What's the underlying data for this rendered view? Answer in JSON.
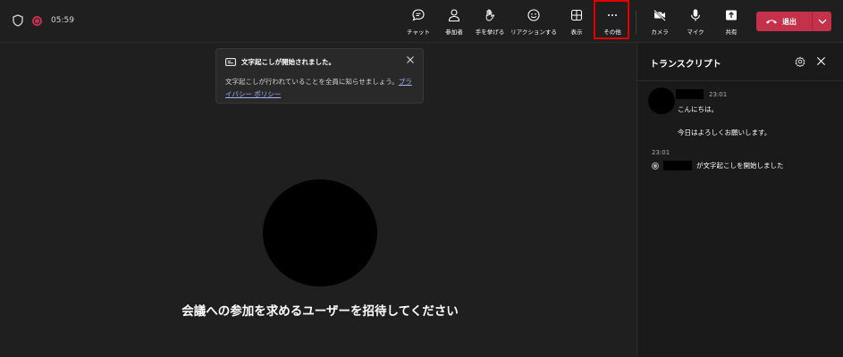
{
  "meeting": {
    "elapsed": "05:59"
  },
  "toolbar": {
    "chat_label": "チャット",
    "participants_label": "参加者",
    "raise_hand_label": "手を挙げる",
    "reactions_label": "リアクションする",
    "view_label": "表示",
    "more_label": "その他",
    "camera_label": "カメラ",
    "mic_label": "マイク",
    "share_label": "共有",
    "leave_label": "退出"
  },
  "toast": {
    "title": "文字起こしが開始されました。",
    "body_text": "文字起こしが行われていることを全員に知らせましょう。",
    "link_text": "プライバシー ポリシー"
  },
  "stage": {
    "invite_text": "会議への参加を求めるユーザーを招待してください"
  },
  "transcript_panel": {
    "title": "トランスクリプト",
    "message": {
      "time": "23:01",
      "lines": [
        "こんにちは。",
        "今日はよろしくお願いします。"
      ]
    },
    "event": {
      "time": "23:01",
      "text": "が文字起こしを開始しました"
    }
  },
  "colors": {
    "background": "#1f1f1f",
    "panel": "#1a1a1a",
    "leave_red": "#c4314b",
    "highlight_box": "#e00000",
    "link": "#a3b3ff"
  },
  "icons": {
    "security": "shield-icon",
    "recording": "recording-dot-icon",
    "chat": "chat-bubble-icon",
    "participants": "person-icon",
    "raise_hand": "hand-icon",
    "reactions": "smiley-icon",
    "view": "grid-icon",
    "more": "ellipsis-icon",
    "camera": "camera-off-icon",
    "mic": "microphone-icon",
    "share": "share-up-arrow-icon",
    "leave": "hang-up-phone-icon",
    "caption": "caption-icon",
    "settings": "gear-icon",
    "close": "close-icon"
  }
}
